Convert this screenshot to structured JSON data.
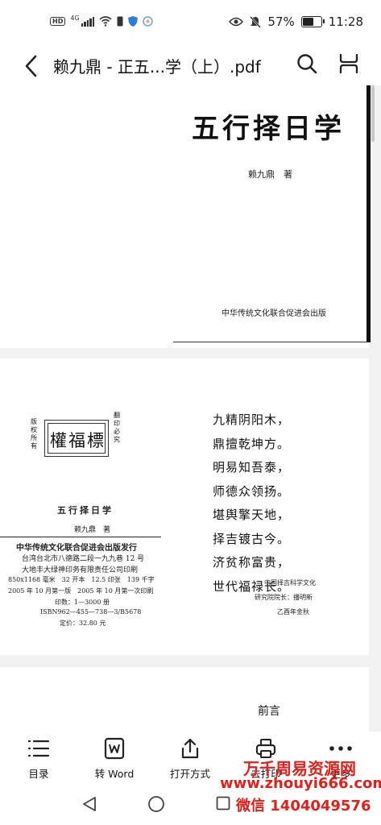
{
  "status_bar": {
    "hd_label": "HD",
    "network_label": "4G",
    "battery_percent": "57%",
    "time": "11:28"
  },
  "header": {
    "title": "赖九鼎 - 正五...学（上）.pdf"
  },
  "page1": {
    "book_title": "五行择日学",
    "author": "赖九鼎　著",
    "publisher": "中华传统文化联合促进会出版"
  },
  "page2": {
    "seal_text": "權福標",
    "side_left": "版权所有",
    "side_right": "翻印必究",
    "book_title": "五行择日学",
    "author": "赖九鼎　著",
    "pub_lines": [
      "中华传统文化联合促进会出版发行",
      "台湾台北市八德路二段一九九巷 12 号",
      "大地丰大绿神印务有限责任公司印刷",
      "850x1168 毫米　32 开本　12.5 印张　139 千字",
      "2005 年 10 月第一版　2005 年 10 月第一次印刷",
      "印数：1—3000 册",
      "ISBN962—455—738—3/B5678",
      "定价：32.80 元"
    ],
    "poem": [
      "九精阴阳木，",
      "鼎擅乾坤方。",
      "明易知吾泰，",
      "师德众领扬。",
      "堪舆擎天地，",
      "择吉镀古今。",
      "济贫称富贵，",
      "世代福禄长。"
    ],
    "signature": [
      "中国择吉科学文化",
      "研究院院长：播明新",
      "乙酉年金秋"
    ]
  },
  "page3": {
    "heading": "前言"
  },
  "toolbar": {
    "items": [
      {
        "label": "目录",
        "icon": "list-icon"
      },
      {
        "label": "转 Word",
        "icon": "word-convert-icon"
      },
      {
        "label": "打开方式",
        "icon": "share-icon"
      },
      {
        "label": "去打印",
        "icon": "printer-icon"
      },
      {
        "label": "更多",
        "icon": "more-icon"
      }
    ]
  },
  "watermark": {
    "line1": "万千周易资源网",
    "line2": "www.zhouyi666.com",
    "line3": "微信 1404049576"
  },
  "colors": {
    "watermark": "#e0201a",
    "background": "#f2f2f2"
  }
}
